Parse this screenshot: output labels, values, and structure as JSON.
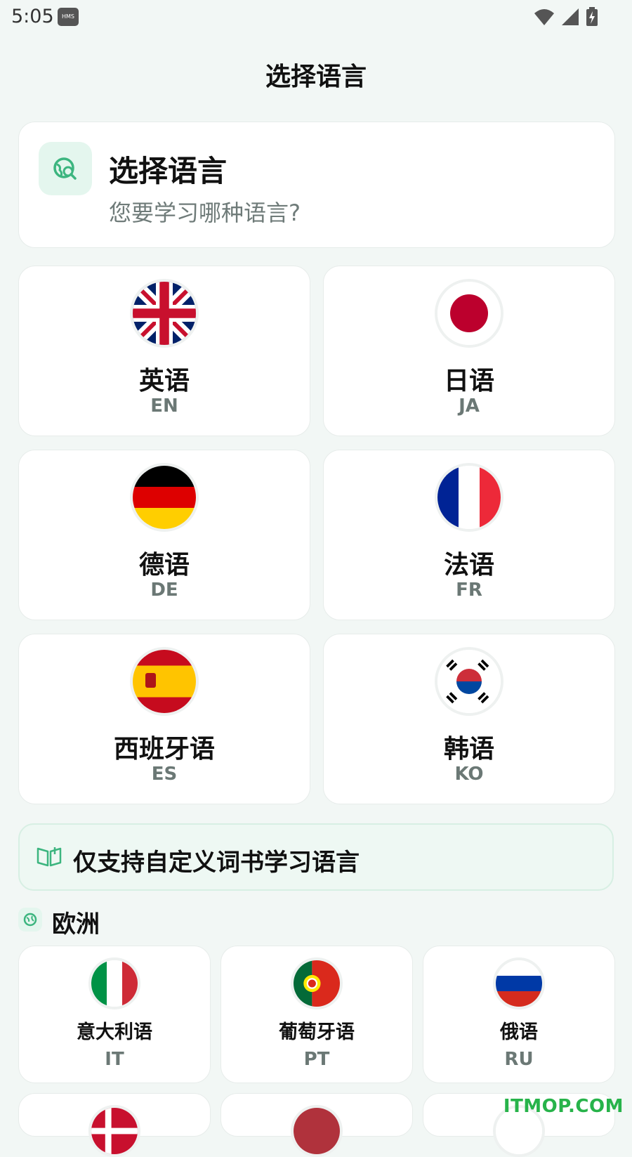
{
  "status": {
    "time": "5:05",
    "hms": "HMS"
  },
  "page": {
    "title": "选择语言"
  },
  "header_card": {
    "title": "选择语言",
    "subtitle": "您要学习哪种语言?"
  },
  "languages": [
    {
      "name": "英语",
      "code": "EN"
    },
    {
      "name": "日语",
      "code": "JA"
    },
    {
      "name": "德语",
      "code": "DE"
    },
    {
      "name": "法语",
      "code": "FR"
    },
    {
      "name": "西班牙语",
      "code": "ES"
    },
    {
      "name": "韩语",
      "code": "KO"
    }
  ],
  "notice": {
    "text": "仅支持自定义词书学习语言"
  },
  "region": {
    "label": "欧洲",
    "languages": [
      {
        "name": "意大利语",
        "code": "IT"
      },
      {
        "name": "葡萄牙语",
        "code": "PT"
      },
      {
        "name": "俄语",
        "code": "RU"
      }
    ]
  },
  "watermark": "ITMOP.COM",
  "colors": {
    "accent": "#3cb57f",
    "background": "#f2f7f5"
  }
}
